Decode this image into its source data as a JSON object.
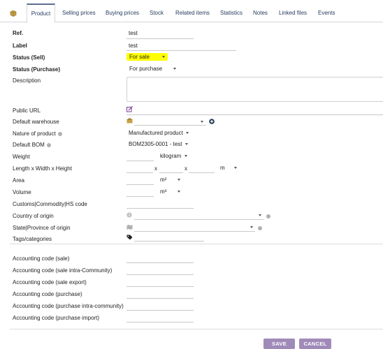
{
  "tabs": [
    {
      "label": "Product"
    },
    {
      "label": "Selling prices"
    },
    {
      "label": "Buying prices"
    },
    {
      "label": "Stock"
    },
    {
      "label": "Related items"
    },
    {
      "label": "Statistics"
    },
    {
      "label": "Notes"
    },
    {
      "label": "Linked files"
    },
    {
      "label": "Events"
    }
  ],
  "form": {
    "ref": {
      "label": "Ref.",
      "value": "test"
    },
    "product_label": {
      "label": "Label",
      "value": "test"
    },
    "status_sell": {
      "label": "Status (Sell)",
      "value": "For sale"
    },
    "status_purchase": {
      "label": "Status (Purchase)",
      "value": "For purchase"
    },
    "description": {
      "label": "Description"
    },
    "public_url": {
      "label": "Public URL"
    },
    "default_warehouse": {
      "label": "Default warehouse"
    },
    "nature": {
      "label": "Nature of product",
      "value": "Manufactured product"
    },
    "default_bom": {
      "label": "Default BOM",
      "value": "BOM2305-0001 - test"
    },
    "weight": {
      "label": "Weight",
      "unit": "kilogram"
    },
    "dimensions": {
      "label": "Length x Width x Height",
      "sep1": "x",
      "sep2": "x",
      "unit": "m"
    },
    "area": {
      "label": "Area",
      "unit": "m²"
    },
    "volume": {
      "label": "Volume",
      "unit": "m³"
    },
    "customs": {
      "label": "Customs|Commodity|HS code"
    },
    "country": {
      "label": "Country of origin"
    },
    "state": {
      "label": "State|Province of origin"
    },
    "tags": {
      "label": "Tags/categories"
    }
  },
  "accounting": [
    {
      "label": "Accounting code (sale)"
    },
    {
      "label": "Accounting code (sale intra-Community)"
    },
    {
      "label": "Accounting code (sale export)"
    },
    {
      "label": "Accounting code (purchase)"
    },
    {
      "label": "Accounting code (purchase intra-community)"
    },
    {
      "label": "Accounting code (purchase import)"
    }
  ],
  "buttons": {
    "save": "SAVE",
    "cancel": "CANCEL"
  },
  "colors": {
    "highlight": "#ffff00",
    "button": "#a08bb8",
    "tab_text": "#263c5c",
    "icon_purple": "#7a3e8e"
  }
}
